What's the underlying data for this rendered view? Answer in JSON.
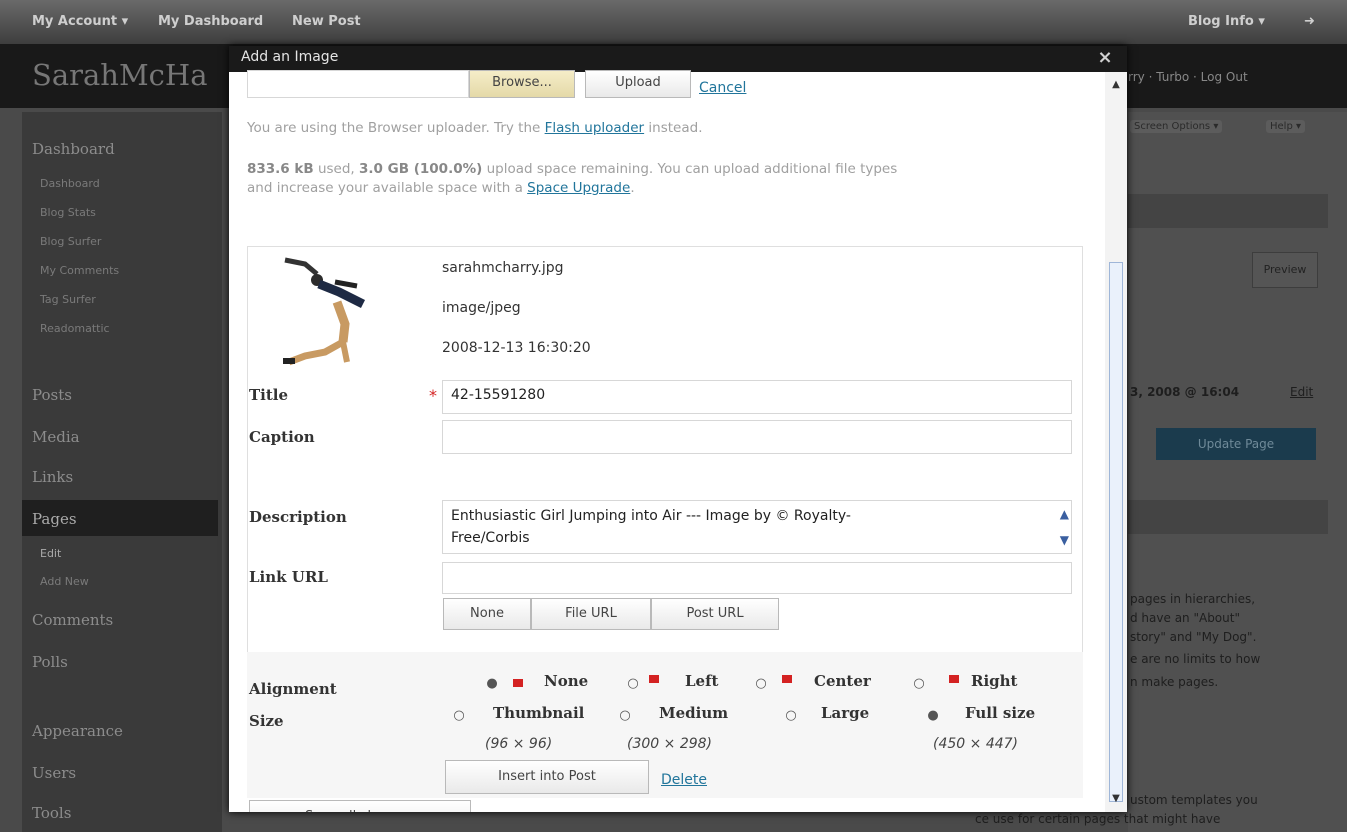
{
  "topbar": {
    "my_account": "My Account ▾",
    "my_dashboard": "My Dashboard",
    "new_post": "New Post",
    "blog_info": "Blog Info ▾"
  },
  "header": {
    "site_title": "SarahMcHa",
    "links": "rry · Turbo · Log Out"
  },
  "sidebar": {
    "dashboard": "Dashboard",
    "sub": [
      "Dashboard",
      "Blog Stats",
      "Blog Surfer",
      "My Comments",
      "Tag Surfer",
      "Readomattic"
    ],
    "posts": "Posts",
    "media": "Media",
    "links": "Links",
    "pages": "Pages",
    "pages_sub": [
      "Edit",
      "Add New"
    ],
    "comments": "Comments",
    "polls": "Polls",
    "appearance": "Appearance",
    "users": "Users",
    "tools": "Tools"
  },
  "right_pane": {
    "screen_options": "Screen Options ▾",
    "help": "Help ▾",
    "preview": "Preview",
    "date_fragment": "3, 2008 @ 16:04",
    "edit": "Edit",
    "update_button": "Update Page",
    "help_text": [
      "pages in hierarchies,",
      "d have an \"About\"",
      "story\" and \"My Dog\".",
      "e are no limits to how",
      "n make pages."
    ],
    "bottom_text": [
      "ustom templates you",
      "ce use for certain pages that might have"
    ]
  },
  "modal": {
    "title": "Add an Image",
    "close_glyph": "×",
    "browse_label": "Browse...",
    "upload_label": "Upload",
    "cancel_label": "Cancel",
    "uploader_prefix": "You are using the Browser uploader. Try the",
    "flash_link": "Flash uploader",
    "uploader_suffix": "instead.",
    "usage_used": "833.6 kB",
    "usage_mid": "used,",
    "usage_remaining": "3.0 GB (100.0%)",
    "usage_line1_rest": "upload space remaining. You can upload additional file types",
    "usage_line2": "and increase your available space with a",
    "space_upgrade_link": "Space Upgrade",
    "file": {
      "name": "sarahmcharry.jpg",
      "mime": "image/jpeg",
      "date": "2008-12-13 16:30:20"
    },
    "labels": {
      "title": "Title",
      "caption": "Caption",
      "description": "Description",
      "link_url": "Link URL",
      "alignment": "Alignment",
      "size": "Size"
    },
    "required_star": "*",
    "title_value": "42-15591280",
    "caption_value": "",
    "description_line1": "Enthusiastic Girl Jumping into Air --- Image by © Royalty-",
    "description_line2": "Free/Corbis",
    "link_url_value": "",
    "link_buttons": [
      "None",
      "File URL",
      "Post URL"
    ],
    "alignment_options": [
      "None",
      "Left",
      "Center",
      "Right"
    ],
    "alignment_selected": "None",
    "size_options": [
      "Thumbnail",
      "Medium",
      "Large",
      "Full size"
    ],
    "size_dims": [
      "(96 × 96)",
      "(300 × 298)",
      "",
      "(450 × 447)"
    ],
    "size_selected": "Full size",
    "insert_button": "Insert into Post",
    "delete_link": "Delete",
    "save_button": "Save all changes"
  },
  "colors": {
    "link": "#21759b",
    "required": "#d42222",
    "overlay": "#4a4a4a"
  }
}
